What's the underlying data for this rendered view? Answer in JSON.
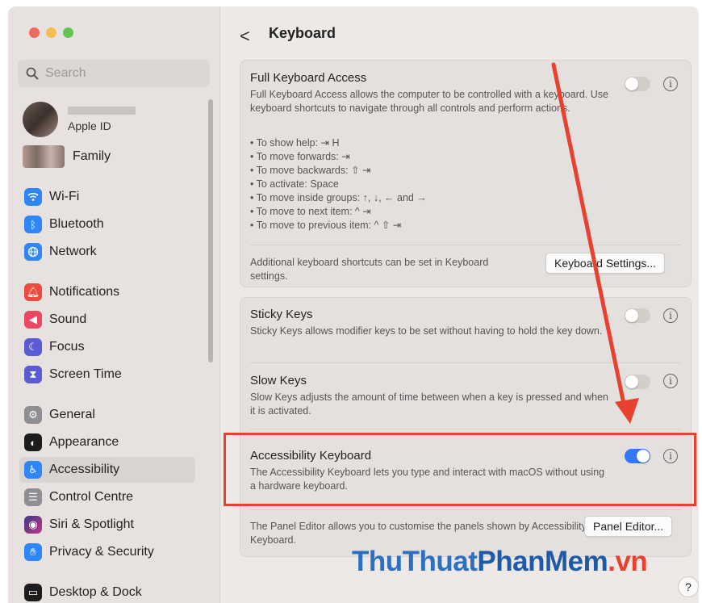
{
  "sidebar": {
    "search_placeholder": "Search",
    "account": {
      "label": "Apple ID"
    },
    "family": {
      "label": "Family"
    },
    "items": [
      {
        "label": "Wi-Fi",
        "icon": "wifi-icon",
        "color": "#2f86f6"
      },
      {
        "label": "Bluetooth",
        "icon": "bluetooth-icon",
        "color": "#2f86f6"
      },
      {
        "label": "Network",
        "icon": "globe-icon",
        "color": "#2f86f6"
      },
      {
        "label": "Notifications",
        "icon": "bell-icon",
        "color": "#ec4b3f"
      },
      {
        "label": "Sound",
        "icon": "speaker-icon",
        "color": "#ec4760"
      },
      {
        "label": "Focus",
        "icon": "moon-icon",
        "color": "#5b5bd6"
      },
      {
        "label": "Screen Time",
        "icon": "hourglass-icon",
        "color": "#5b5bd6"
      },
      {
        "label": "General",
        "icon": "gear-icon",
        "color": "#8e8e93"
      },
      {
        "label": "Appearance",
        "icon": "appearance-icon",
        "color": "#1c1c1e"
      },
      {
        "label": "Accessibility",
        "icon": "accessibility-icon",
        "color": "#2f86f6"
      },
      {
        "label": "Control Centre",
        "icon": "control-centre-icon",
        "color": "#8e8e93"
      },
      {
        "label": "Siri & Spotlight",
        "icon": "siri-icon",
        "color": "#3a3a8c"
      },
      {
        "label": "Privacy & Security",
        "icon": "hand-icon",
        "color": "#2f86f6"
      },
      {
        "label": "Desktop & Dock",
        "icon": "dock-icon",
        "color": "#1c1c1e"
      }
    ]
  },
  "header": {
    "back": "<",
    "title": "Keyboard"
  },
  "full_keyboard_access": {
    "title": "Full Keyboard Access",
    "description": "Full Keyboard Access allows the computer to be controlled with a keyboard. Use keyboard shortcuts to navigate through all controls and perform actions.",
    "shortcuts": [
      "• To show help: ⇥ H",
      "• To move forwards: ⇥",
      "• To move backwards: ⇧ ⇥",
      "• To activate: Space",
      "• To move inside groups: ↑, ↓, ← and →",
      "• To move to next item: ^ ⇥",
      "• To move to previous item: ^ ⇧ ⇥"
    ],
    "enabled": false,
    "additional_text": "Additional keyboard shortcuts can be set in Keyboard settings.",
    "settings_button": "Keyboard Settings..."
  },
  "sticky_keys": {
    "title": "Sticky Keys",
    "description": "Sticky Keys allows modifier keys to be set without having to hold the key down.",
    "enabled": false
  },
  "slow_keys": {
    "title": "Slow Keys",
    "description": "Slow Keys adjusts the amount of time between when a key is pressed and when it is activated.",
    "enabled": false
  },
  "accessibility_keyboard": {
    "title": "Accessibility Keyboard",
    "description": "The Accessibility Keyboard lets you type and interact with macOS without using a hardware keyboard.",
    "enabled": true,
    "panel_text": "The Panel Editor allows you to customise the panels shown by Accessibility Keyboard.",
    "panel_button": "Panel Editor..."
  },
  "info_glyph": "i",
  "help_glyph": "?",
  "watermark": {
    "part1": "ThuThuat",
    "part2": "PhanMem",
    "part3": ".vn"
  },
  "colors": {
    "accent": "#3478f6",
    "highlight": "#e8412f"
  }
}
